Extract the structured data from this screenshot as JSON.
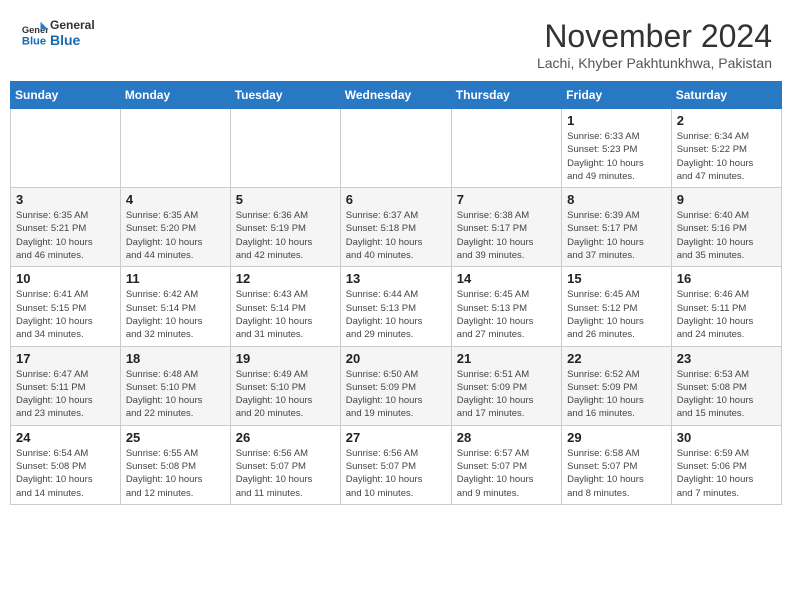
{
  "header": {
    "logo_general": "General",
    "logo_blue": "Blue",
    "month_title": "November 2024",
    "subtitle": "Lachi, Khyber Pakhtunkhwa, Pakistan"
  },
  "days_of_week": [
    "Sunday",
    "Monday",
    "Tuesday",
    "Wednesday",
    "Thursday",
    "Friday",
    "Saturday"
  ],
  "weeks": [
    [
      {
        "day": "",
        "info": ""
      },
      {
        "day": "",
        "info": ""
      },
      {
        "day": "",
        "info": ""
      },
      {
        "day": "",
        "info": ""
      },
      {
        "day": "",
        "info": ""
      },
      {
        "day": "1",
        "info": "Sunrise: 6:33 AM\nSunset: 5:23 PM\nDaylight: 10 hours\nand 49 minutes."
      },
      {
        "day": "2",
        "info": "Sunrise: 6:34 AM\nSunset: 5:22 PM\nDaylight: 10 hours\nand 47 minutes."
      }
    ],
    [
      {
        "day": "3",
        "info": "Sunrise: 6:35 AM\nSunset: 5:21 PM\nDaylight: 10 hours\nand 46 minutes."
      },
      {
        "day": "4",
        "info": "Sunrise: 6:35 AM\nSunset: 5:20 PM\nDaylight: 10 hours\nand 44 minutes."
      },
      {
        "day": "5",
        "info": "Sunrise: 6:36 AM\nSunset: 5:19 PM\nDaylight: 10 hours\nand 42 minutes."
      },
      {
        "day": "6",
        "info": "Sunrise: 6:37 AM\nSunset: 5:18 PM\nDaylight: 10 hours\nand 40 minutes."
      },
      {
        "day": "7",
        "info": "Sunrise: 6:38 AM\nSunset: 5:17 PM\nDaylight: 10 hours\nand 39 minutes."
      },
      {
        "day": "8",
        "info": "Sunrise: 6:39 AM\nSunset: 5:17 PM\nDaylight: 10 hours\nand 37 minutes."
      },
      {
        "day": "9",
        "info": "Sunrise: 6:40 AM\nSunset: 5:16 PM\nDaylight: 10 hours\nand 35 minutes."
      }
    ],
    [
      {
        "day": "10",
        "info": "Sunrise: 6:41 AM\nSunset: 5:15 PM\nDaylight: 10 hours\nand 34 minutes."
      },
      {
        "day": "11",
        "info": "Sunrise: 6:42 AM\nSunset: 5:14 PM\nDaylight: 10 hours\nand 32 minutes."
      },
      {
        "day": "12",
        "info": "Sunrise: 6:43 AM\nSunset: 5:14 PM\nDaylight: 10 hours\nand 31 minutes."
      },
      {
        "day": "13",
        "info": "Sunrise: 6:44 AM\nSunset: 5:13 PM\nDaylight: 10 hours\nand 29 minutes."
      },
      {
        "day": "14",
        "info": "Sunrise: 6:45 AM\nSunset: 5:13 PM\nDaylight: 10 hours\nand 27 minutes."
      },
      {
        "day": "15",
        "info": "Sunrise: 6:45 AM\nSunset: 5:12 PM\nDaylight: 10 hours\nand 26 minutes."
      },
      {
        "day": "16",
        "info": "Sunrise: 6:46 AM\nSunset: 5:11 PM\nDaylight: 10 hours\nand 24 minutes."
      }
    ],
    [
      {
        "day": "17",
        "info": "Sunrise: 6:47 AM\nSunset: 5:11 PM\nDaylight: 10 hours\nand 23 minutes."
      },
      {
        "day": "18",
        "info": "Sunrise: 6:48 AM\nSunset: 5:10 PM\nDaylight: 10 hours\nand 22 minutes."
      },
      {
        "day": "19",
        "info": "Sunrise: 6:49 AM\nSunset: 5:10 PM\nDaylight: 10 hours\nand 20 minutes."
      },
      {
        "day": "20",
        "info": "Sunrise: 6:50 AM\nSunset: 5:09 PM\nDaylight: 10 hours\nand 19 minutes."
      },
      {
        "day": "21",
        "info": "Sunrise: 6:51 AM\nSunset: 5:09 PM\nDaylight: 10 hours\nand 17 minutes."
      },
      {
        "day": "22",
        "info": "Sunrise: 6:52 AM\nSunset: 5:09 PM\nDaylight: 10 hours\nand 16 minutes."
      },
      {
        "day": "23",
        "info": "Sunrise: 6:53 AM\nSunset: 5:08 PM\nDaylight: 10 hours\nand 15 minutes."
      }
    ],
    [
      {
        "day": "24",
        "info": "Sunrise: 6:54 AM\nSunset: 5:08 PM\nDaylight: 10 hours\nand 14 minutes."
      },
      {
        "day": "25",
        "info": "Sunrise: 6:55 AM\nSunset: 5:08 PM\nDaylight: 10 hours\nand 12 minutes."
      },
      {
        "day": "26",
        "info": "Sunrise: 6:56 AM\nSunset: 5:07 PM\nDaylight: 10 hours\nand 11 minutes."
      },
      {
        "day": "27",
        "info": "Sunrise: 6:56 AM\nSunset: 5:07 PM\nDaylight: 10 hours\nand 10 minutes."
      },
      {
        "day": "28",
        "info": "Sunrise: 6:57 AM\nSunset: 5:07 PM\nDaylight: 10 hours\nand 9 minutes."
      },
      {
        "day": "29",
        "info": "Sunrise: 6:58 AM\nSunset: 5:07 PM\nDaylight: 10 hours\nand 8 minutes."
      },
      {
        "day": "30",
        "info": "Sunrise: 6:59 AM\nSunset: 5:06 PM\nDaylight: 10 hours\nand 7 minutes."
      }
    ]
  ]
}
